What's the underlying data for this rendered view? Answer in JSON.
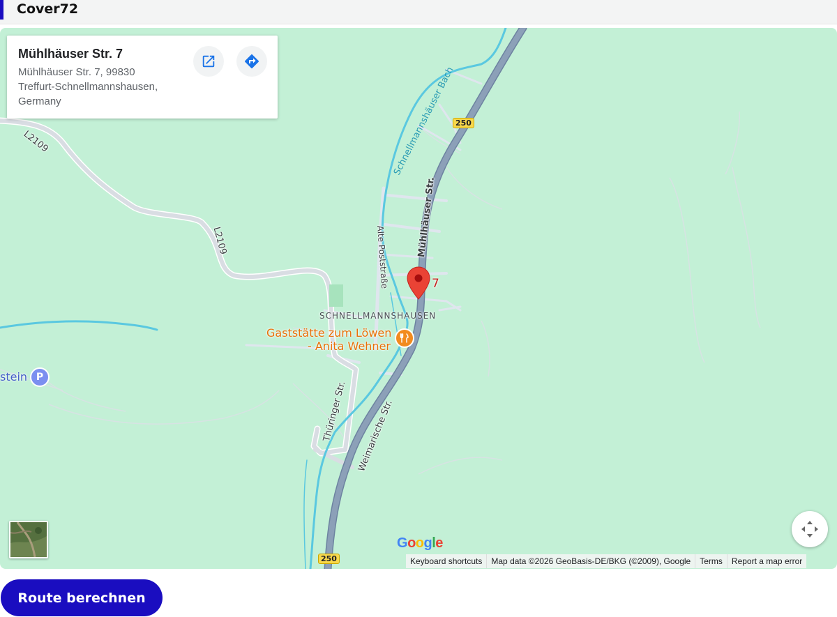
{
  "header": {
    "title": "Cover72"
  },
  "infocard": {
    "name": "Mühlhäuser Str. 7",
    "address_lines": [
      "Mühlhäuser Str. 7, 99830",
      "Treffurt-Schnellmannshausen,",
      "Germany"
    ],
    "open_icon": "open-in-new-icon",
    "directions_icon": "directions-icon"
  },
  "map": {
    "labels": {
      "l2109_a": "L2109",
      "l2109_b": "L2109",
      "bach": "Schnellmannshäuser Bach",
      "muhl": "Mühlhäuser Str.",
      "alte": "Alte Poststraße",
      "town": "SCHNELLMANNSHAUSEN",
      "thur": "Thüringer Str.",
      "weim": "Weimarische Str.",
      "poi_line1": "Gaststätte zum Löwen",
      "poi_line2": "- Anita Wehner",
      "stein": "stein",
      "marker_label": "7",
      "shield_top": "250",
      "shield_bottom": "250",
      "parking": "P"
    },
    "logo": "Google",
    "logo_colors": [
      "#4285F4",
      "#EA4335",
      "#FBBC05",
      "#4285F4",
      "#34A853",
      "#EA4335"
    ],
    "footer": {
      "shortcuts": "Keyboard shortcuts",
      "mapdata": "Map data ©2026 GeoBasis-DE/BKG (©2009), Google",
      "terms": "Terms",
      "report": "Report a map error"
    }
  },
  "route_button": {
    "label": "Route berechnen"
  },
  "colors": {
    "accent": "#1a0dc0",
    "map_bg": "#c3f0d6",
    "main_road": "#8ca0b8",
    "water": "#5ac8e0",
    "marker": "#ea4335",
    "poi": "#e8710a",
    "icon_blue": "#1a73e8"
  }
}
